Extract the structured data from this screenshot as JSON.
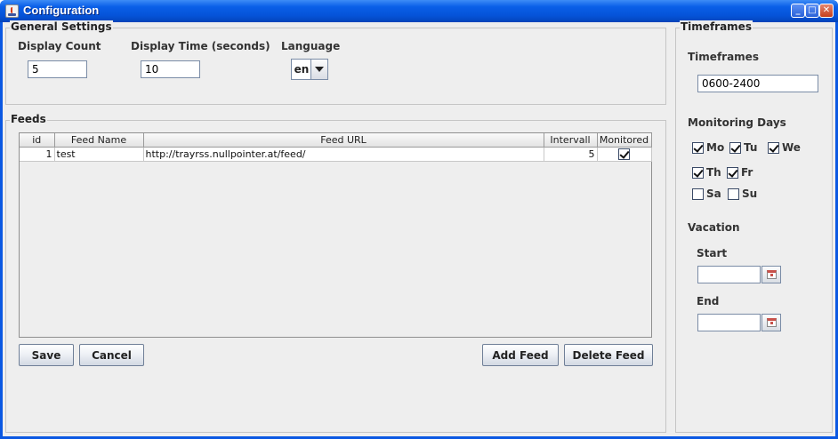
{
  "window": {
    "title": "Configuration",
    "minimize": "_",
    "maximize": "□",
    "close": "✕"
  },
  "general": {
    "title": "General Settings",
    "display_count_label": "Display Count",
    "display_count_value": "5",
    "display_time_label": "Display Time (seconds)",
    "display_time_value": "10",
    "language_label": "Language",
    "language_value": "en"
  },
  "feeds": {
    "title": "Feeds",
    "columns": [
      "id",
      "Feed Name",
      "Feed URL",
      "Intervall",
      "Monitored"
    ],
    "rows": [
      {
        "id": "1",
        "name": "test",
        "url": "http://trayrss.nullpointer.at/feed/",
        "interval": "5",
        "monitored": true
      }
    ],
    "save_label": "Save",
    "cancel_label": "Cancel",
    "add_label": "Add Feed",
    "delete_label": "Delete Feed"
  },
  "timeframes": {
    "group_title": "Timeframes",
    "label": "Timeframes",
    "value": "0600-2400",
    "days_label": "Monitoring Days",
    "days": [
      {
        "label": "Mo",
        "checked": true
      },
      {
        "label": "Tu",
        "checked": true
      },
      {
        "label": "We",
        "checked": true
      },
      {
        "label": "Th",
        "checked": true
      },
      {
        "label": "Fr",
        "checked": true
      },
      {
        "label": "Sa",
        "checked": false
      },
      {
        "label": "Su",
        "checked": false
      }
    ],
    "vacation_label": "Vacation",
    "start_label": "Start",
    "start_value": "",
    "end_label": "End",
    "end_value": ""
  },
  "icons": {
    "app": "java-cup-icon",
    "calendar": "calendar-icon"
  }
}
